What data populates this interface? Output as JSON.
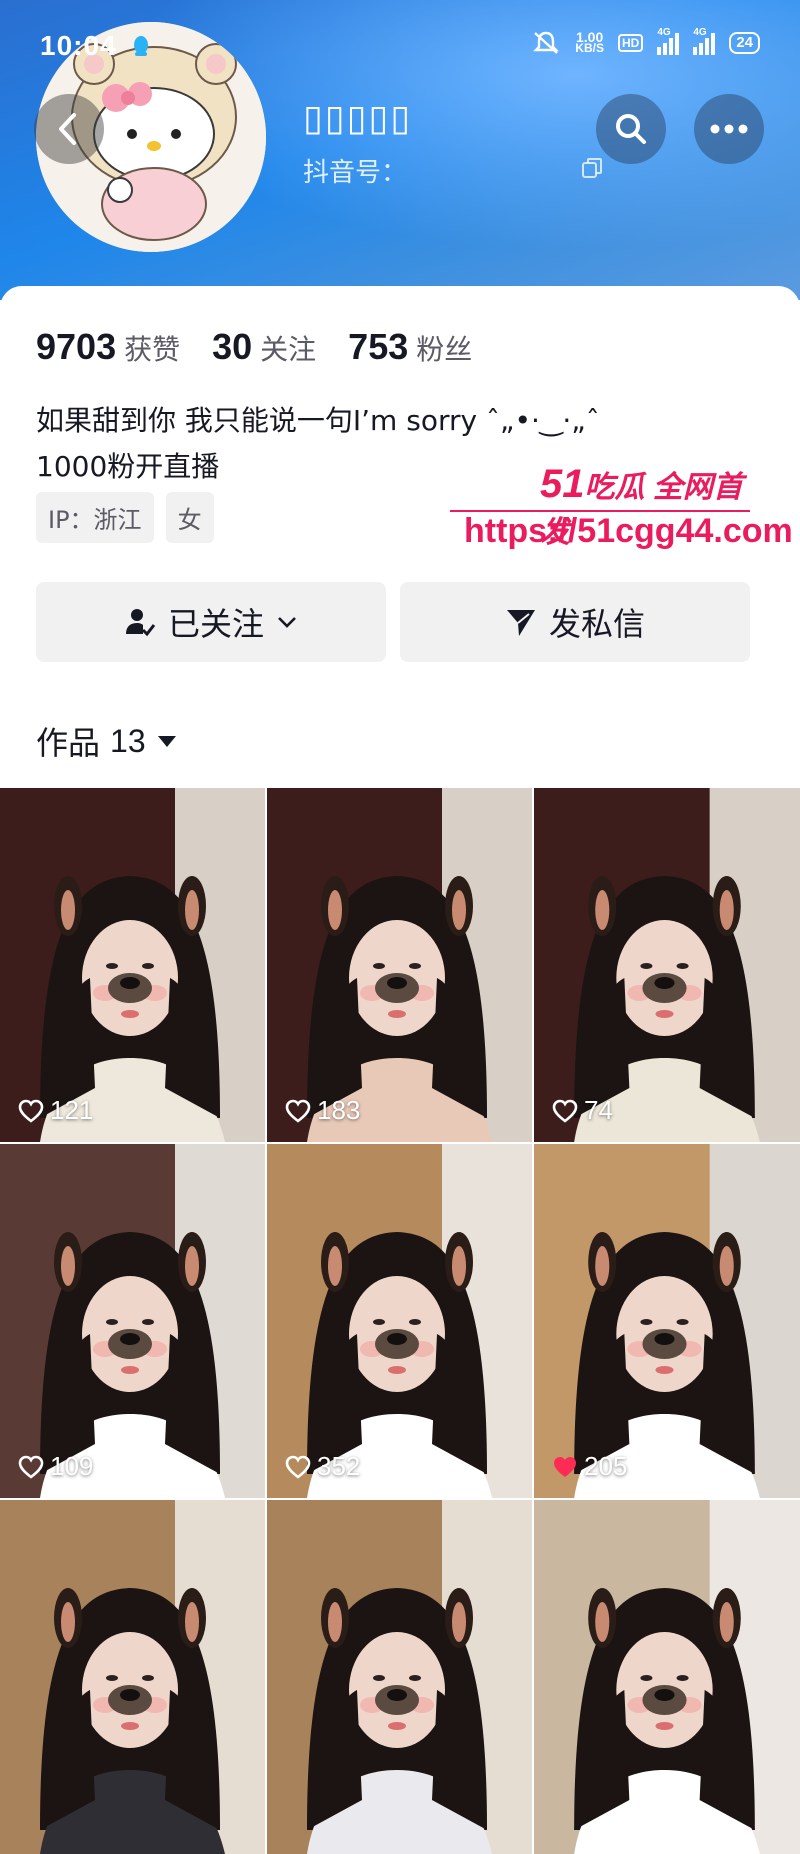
{
  "status_bar": {
    "time": "10:04",
    "net_speed_value": "1.00",
    "net_speed_unit": "KB/S",
    "hd_label": "HD",
    "signal_label_1": "4G",
    "signal_label_2": "4G",
    "battery": "24"
  },
  "profile": {
    "nickname": "▯▯▯▯▯",
    "douyin_id_label": "抖音号："
  },
  "stats": [
    {
      "value": "9703",
      "label": "获赞"
    },
    {
      "value": "30",
      "label": "关注"
    },
    {
      "value": "753",
      "label": "粉丝"
    }
  ],
  "bio": {
    "line1": "如果甜到你 我只能说一句I’m sorry ˆ„•·‿·„ˆ",
    "line2": "1000粉开直播"
  },
  "tags": [
    "IP：浙江",
    "女"
  ],
  "watermark": {
    "brand_num": "51",
    "brand_text": "吃瓜 全网首发",
    "url": "https://51cgg44.com"
  },
  "buttons": {
    "follow": "已关注",
    "message": "发私信"
  },
  "works": {
    "label": "作品",
    "count": "13"
  },
  "videos": [
    {
      "likes": "121",
      "liked": false
    },
    {
      "likes": "183",
      "liked": false
    },
    {
      "likes": "74",
      "liked": false
    },
    {
      "likes": "109",
      "liked": false
    },
    {
      "likes": "352",
      "liked": false
    },
    {
      "likes": "205",
      "liked": true
    },
    {
      "likes": "",
      "liked": false
    },
    {
      "likes": "",
      "liked": false
    },
    {
      "likes": "",
      "liked": false
    }
  ],
  "colors": {
    "header_blue": "#1f86ea",
    "watermark_pink": "#ea1c5d",
    "liked_red": "#fe2c55",
    "button_gray": "#f1f1f2"
  }
}
